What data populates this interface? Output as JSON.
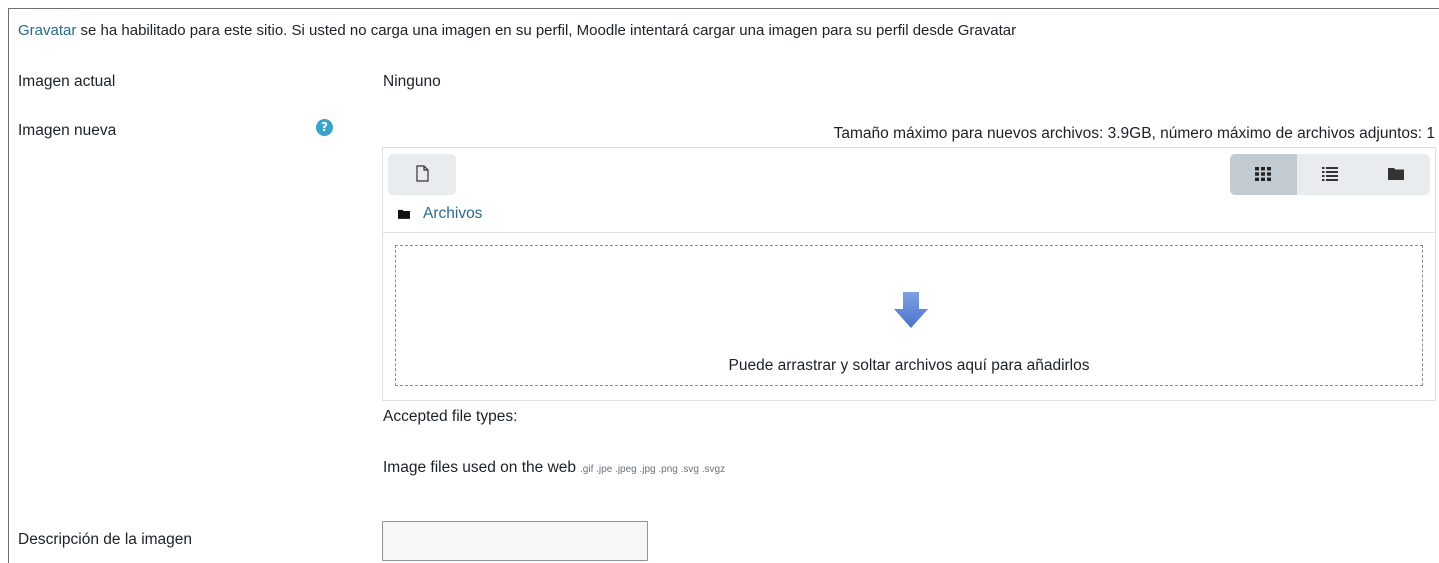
{
  "notice": {
    "link_text": "Gravatar",
    "text": " se ha habilitado para este sitio. Si usted no carga una imagen en su perfil, Moodle intentará cargar una imagen para su perfil desde Gravatar"
  },
  "current_image": {
    "label": "Imagen actual",
    "value": "Ninguno"
  },
  "new_image": {
    "label": "Imagen nueva",
    "help_icon": "question-circle-icon",
    "max_info": "Tamaño máximo para nuevos archivos: 3.9GB, número máximo de archivos adjuntos: 1"
  },
  "filepicker": {
    "add_icon": "file-icon",
    "view_icons": [
      "grid-icon",
      "list-icon",
      "folder-icon"
    ],
    "folder_icon": "folder-icon",
    "folder_label": "Archivos",
    "drop_icon": "down-arrow-icon",
    "drop_text": "Puede arrastrar y soltar archivos aquí para añadirlos"
  },
  "accepted": {
    "label": "Accepted file types:",
    "group": "Image files used on the web",
    "extensions": ".gif .jpe .jpeg .jpg .png .svg .svgz"
  },
  "description": {
    "label": "Descripción de la imagen",
    "value": ""
  },
  "colors": {
    "link": "#2a6b8a",
    "help": "#3aa3c7",
    "arrow": "#5b86d6",
    "active_view": "#c1cbd1"
  }
}
